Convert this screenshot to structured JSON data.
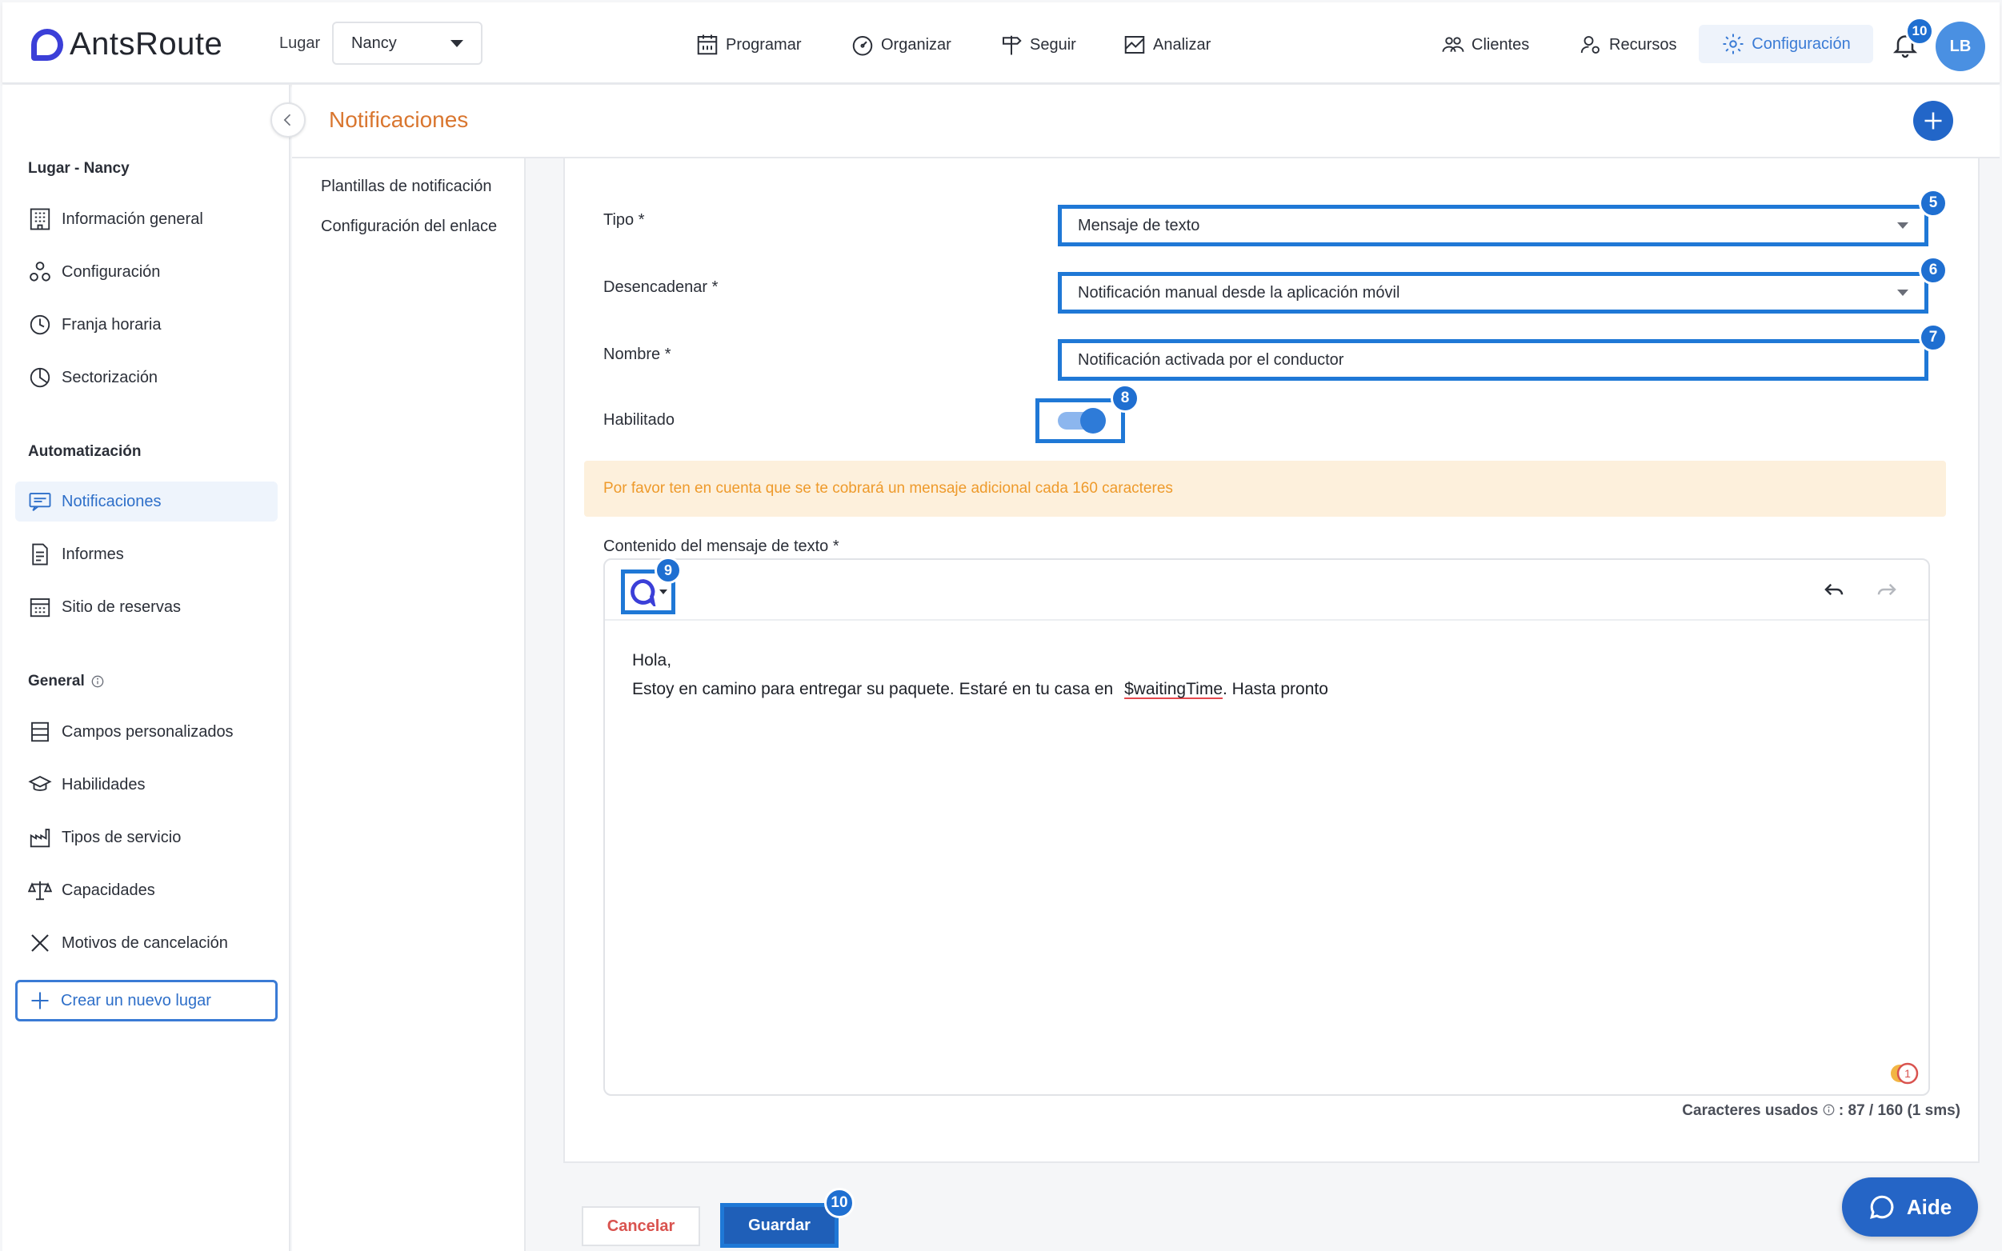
{
  "app": {
    "logo_text": "AntsRoute"
  },
  "topbar": {
    "lugar_label": "Lugar",
    "lugar_value": "Nancy",
    "nav": [
      {
        "label": "Programar",
        "icon": "calendar-icon"
      },
      {
        "label": "Organizar",
        "icon": "gauge-icon"
      },
      {
        "label": "Seguir",
        "icon": "signpost-icon"
      },
      {
        "label": "Analizar",
        "icon": "chart-icon"
      }
    ],
    "right_nav": [
      {
        "label": "Clientes",
        "icon": "users-icon"
      },
      {
        "label": "Recursos",
        "icon": "user-gear-icon"
      },
      {
        "label": "Configuración",
        "icon": "gear-icon",
        "active": true
      }
    ],
    "notifications_count": "10",
    "avatar_initials": "LB"
  },
  "sidebar": {
    "section_lugar": "Lugar - Nancy",
    "items_lugar": [
      {
        "label": "Información general",
        "icon": "building-icon"
      },
      {
        "label": "Configuración",
        "icon": "nodes-icon"
      },
      {
        "label": "Franja horaria",
        "icon": "clock-icon"
      },
      {
        "label": "Sectorización",
        "icon": "pie-icon"
      }
    ],
    "section_auto": "Automatización",
    "items_auto": [
      {
        "label": "Notificaciones",
        "icon": "message-icon",
        "active": true
      },
      {
        "label": "Informes",
        "icon": "document-icon"
      },
      {
        "label": "Sitio de reservas",
        "icon": "calendar-grid-icon"
      }
    ],
    "section_general": "General",
    "items_general": [
      {
        "label": "Campos personalizados",
        "icon": "fields-icon"
      },
      {
        "label": "Habilidades",
        "icon": "graduation-icon"
      },
      {
        "label": "Tipos de servicio",
        "icon": "factory-icon"
      },
      {
        "label": "Capacidades",
        "icon": "scale-icon"
      },
      {
        "label": "Motivos de cancelación",
        "icon": "x-icon"
      }
    ],
    "new_place": "Crear un nuevo lugar"
  },
  "page": {
    "title": "Notificaciones"
  },
  "subnav": [
    "Plantillas de notificación",
    "Configuración del enlace"
  ],
  "form": {
    "tipo_label": "Tipo *",
    "tipo_value": "Mensaje de texto",
    "trigger_label": "Desencadenar *",
    "trigger_value": "Notificación manual desde la aplicación móvil",
    "name_label": "Nombre *",
    "name_value": "Notificación activada por el conductor",
    "enabled_label": "Habilitado",
    "enabled": true,
    "warning": "Por favor ten en cuenta que se te cobrará un mensaje adicional cada 160 caracteres",
    "content_label": "Contenido del mensaje de texto *",
    "content_line1": "Hola,",
    "content_line2_prefix": "Estoy en camino para entregar su paquete. Estaré en tu casa en",
    "content_variable": "$waitingTime",
    "content_line2_suffix": ". Hasta pronto",
    "grammar_count": "1",
    "counter_label": "Caracteres usados",
    "counter_value": ": 87 / 160 (1 sms)"
  },
  "buttons": {
    "cancel": "Cancelar",
    "save": "Guardar",
    "help": "Aide"
  },
  "step_badges": {
    "tipo": "5",
    "trigger": "6",
    "name": "7",
    "toggle": "8",
    "insert": "9",
    "save": "10"
  },
  "colors": {
    "accent": "#1f78d6",
    "title": "#d9762f",
    "warning_bg": "#fdf0dc",
    "warning_text": "#ee9a2b"
  }
}
